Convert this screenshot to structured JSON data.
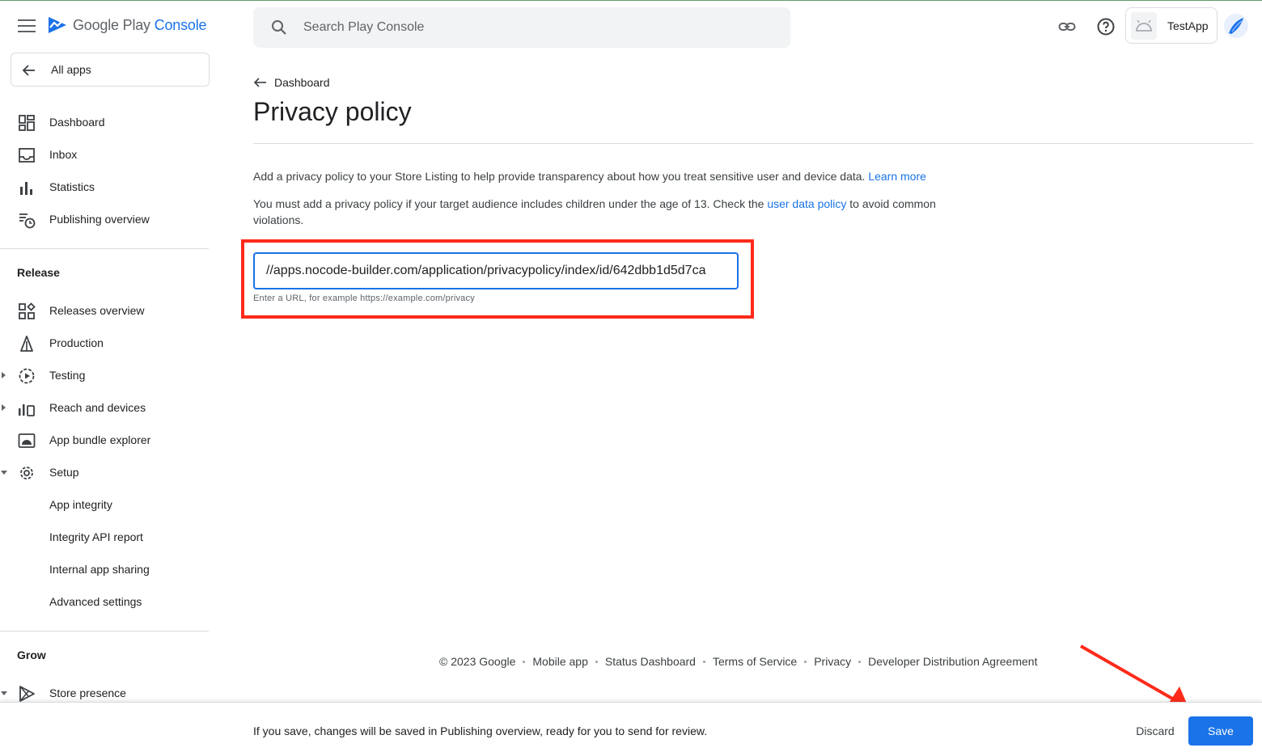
{
  "header": {
    "logo_word1": "Google Play",
    "logo_word2": "Console",
    "search_placeholder": "Search Play Console",
    "app_name": "TestApp",
    "icons": [
      "menu-icon",
      "play-console-logo",
      "search-icon",
      "link-icon",
      "help-icon",
      "android-icon",
      "avatar"
    ]
  },
  "sidebar": {
    "all_apps": "All apps",
    "top_items": [
      {
        "label": "Dashboard",
        "icon": "dashboard-icon"
      },
      {
        "label": "Inbox",
        "icon": "inbox-icon"
      },
      {
        "label": "Statistics",
        "icon": "statistics-icon"
      },
      {
        "label": "Publishing overview",
        "icon": "publishing-overview-icon"
      }
    ],
    "release_title": "Release",
    "release_items": [
      {
        "label": "Releases overview",
        "icon": "releases-overview-icon"
      },
      {
        "label": "Production",
        "icon": "production-icon"
      },
      {
        "label": "Testing",
        "icon": "testing-icon"
      },
      {
        "label": "Reach and devices",
        "icon": "reach-devices-icon"
      },
      {
        "label": "App bundle explorer",
        "icon": "app-bundle-icon"
      },
      {
        "label": "Setup",
        "icon": "gear-icon"
      }
    ],
    "setup_items": [
      {
        "label": "App integrity"
      },
      {
        "label": "Integrity API report"
      },
      {
        "label": "Internal app sharing"
      },
      {
        "label": "Advanced settings"
      }
    ],
    "grow_title": "Grow",
    "grow_items": [
      {
        "label": "Store presence",
        "icon": "store-presence-icon"
      }
    ]
  },
  "main": {
    "breadcrumb": "Dashboard",
    "title": "Privacy policy",
    "para1_text": "Add a privacy policy to your Store Listing to help provide transparency about how you treat sensitive user and device data.",
    "para1_link": "Learn more",
    "para2_before": "You must add a privacy policy if your target audience includes children under the age of 13. Check the",
    "para2_link": "user data policy",
    "para2_after": "to avoid common violations.",
    "url_value": "//apps.nocode-builder.com/application/privacypolicy/index/id/642dbb1d5d7ca",
    "url_helper": "Enter a URL, for example https://example.com/privacy",
    "highlight_color": "#ff2a1a"
  },
  "footer": {
    "links": [
      "© 2023 Google",
      "Mobile app",
      "Status Dashboard",
      "Terms of Service",
      "Privacy",
      "Developer Distribution Agreement"
    ]
  },
  "bottom_bar": {
    "message": "If you save, changes will be saved in Publishing overview, ready for you to send for review.",
    "discard": "Discard",
    "save": "Save",
    "save_color": "#1a73e8"
  }
}
